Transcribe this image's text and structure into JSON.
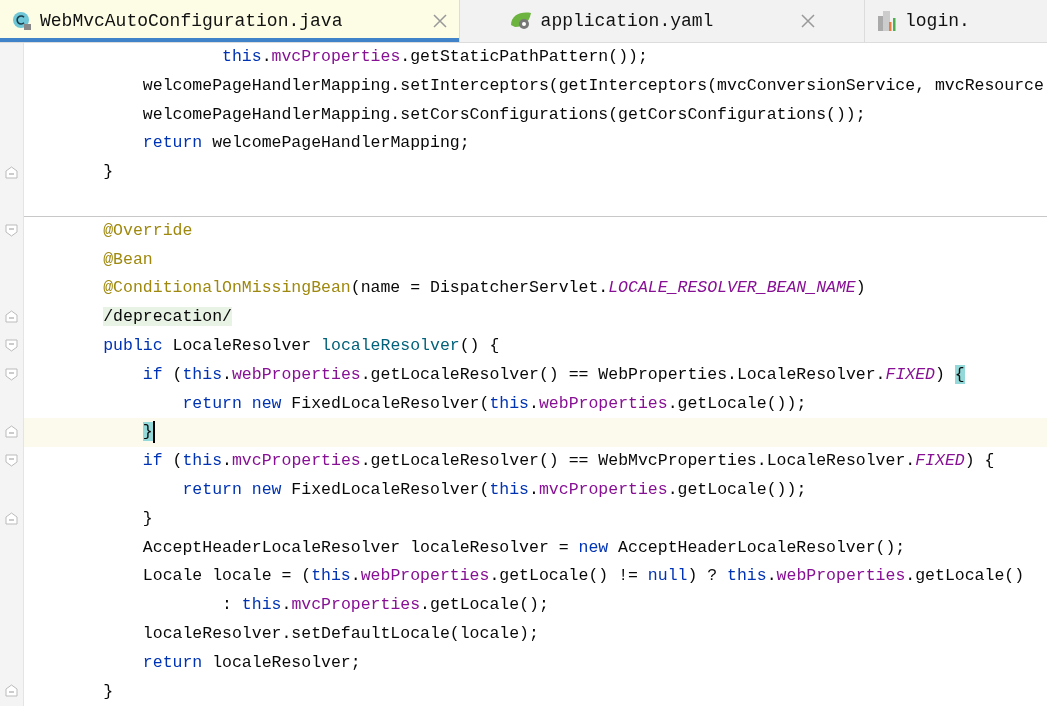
{
  "tabs": [
    {
      "label": "WebMvcAutoConfiguration.java",
      "kind": "java_class",
      "selected": true,
      "closable": true
    },
    {
      "label": "application.yaml",
      "kind": "spring",
      "selected": false,
      "closable": true
    },
    {
      "label": "login.",
      "kind": "html",
      "selected": false,
      "closable": false
    }
  ],
  "lines": [
    {
      "tokens": [
        {
          "kind": "keyword",
          "text": "                    this"
        },
        {
          "kind": "plain",
          "text": "."
        },
        {
          "kind": "field",
          "text": "mvcProperties"
        },
        {
          "kind": "plain",
          "text": ".getStaticPathPattern());"
        }
      ]
    },
    {
      "tokens": [
        {
          "kind": "plain",
          "text": "            welcomePageHandlerMapping.setInterceptors(getInterceptors(mvcConversionService, mvcResource"
        }
      ]
    },
    {
      "tokens": [
        {
          "kind": "plain",
          "text": "            welcomePageHandlerMapping.setCorsConfigurations(getCorsConfigurations());"
        }
      ]
    },
    {
      "tokens": [
        {
          "kind": "keyword",
          "text": "            return"
        },
        {
          "kind": "plain",
          "text": " welcomePageHandlerMapping;"
        }
      ]
    },
    {
      "fold": {
        "kind": "end"
      },
      "tokens": [
        {
          "kind": "plain",
          "text": "        }"
        }
      ]
    },
    {
      "fold": {
        "kind": "start"
      },
      "separator_above": true,
      "tokens": [
        {
          "kind": "annotation",
          "text": "        @Override"
        }
      ]
    },
    {
      "tokens": [
        {
          "kind": "annotation",
          "text": "        @Bean"
        }
      ]
    },
    {
      "tokens": [
        {
          "kind": "annotation",
          "text": "        @ConditionalOnMissingBean"
        },
        {
          "kind": "plain",
          "text": "(name = DispatcherServlet."
        },
        {
          "kind": "constant",
          "text": "LOCALE_RESOLVER_BEAN_NAME"
        },
        {
          "kind": "plain",
          "text": ")"
        }
      ]
    },
    {
      "fold": {
        "kind": "end"
      },
      "tokens": [
        {
          "kind": "folded",
          "text": "        /deprecation/"
        }
      ]
    },
    {
      "fold": {
        "kind": "start"
      },
      "tokens": [
        {
          "kind": "keyword",
          "text": "        public"
        },
        {
          "kind": "plain",
          "text": " LocaleResolver "
        },
        {
          "kind": "method",
          "text": "localeResolver"
        },
        {
          "kind": "plain",
          "text": "() {"
        }
      ]
    },
    {
      "fold": {
        "kind": "start"
      },
      "tokens": [
        {
          "kind": "keyword",
          "text": "            if"
        },
        {
          "kind": "plain",
          "text": " ("
        },
        {
          "kind": "keyword",
          "text": "this"
        },
        {
          "kind": "plain",
          "text": "."
        },
        {
          "kind": "field",
          "text": "webProperties"
        },
        {
          "kind": "plain",
          "text": ".getLocaleResolver() == WebProperties.LocaleResolver."
        },
        {
          "kind": "constant",
          "text": "FIXED"
        },
        {
          "kind": "plain",
          "text": ") "
        },
        {
          "kind": "brace_match",
          "text": "{"
        }
      ]
    },
    {
      "tokens": [
        {
          "kind": "keyword",
          "text": "                return new"
        },
        {
          "kind": "plain",
          "text": " FixedLocaleResolver("
        },
        {
          "kind": "keyword",
          "text": "this"
        },
        {
          "kind": "plain",
          "text": "."
        },
        {
          "kind": "field",
          "text": "webProperties"
        },
        {
          "kind": "plain",
          "text": ".getLocale());"
        }
      ]
    },
    {
      "fold": {
        "kind": "end"
      },
      "current": true,
      "tokens": [
        {
          "kind": "brace_match",
          "text": "            }"
        }
      ]
    },
    {
      "fold": {
        "kind": "start"
      },
      "tokens": [
        {
          "kind": "keyword",
          "text": "            if"
        },
        {
          "kind": "plain",
          "text": " ("
        },
        {
          "kind": "keyword",
          "text": "this"
        },
        {
          "kind": "plain",
          "text": "."
        },
        {
          "kind": "field",
          "text": "mvcProperties"
        },
        {
          "kind": "plain",
          "text": ".getLocaleResolver() == WebMvcProperties.LocaleResolver."
        },
        {
          "kind": "constant",
          "text": "FIXED"
        },
        {
          "kind": "plain",
          "text": ") {"
        }
      ]
    },
    {
      "tokens": [
        {
          "kind": "keyword",
          "text": "                return new"
        },
        {
          "kind": "plain",
          "text": " FixedLocaleResolver("
        },
        {
          "kind": "keyword",
          "text": "this"
        },
        {
          "kind": "plain",
          "text": "."
        },
        {
          "kind": "field",
          "text": "mvcProperties"
        },
        {
          "kind": "plain",
          "text": ".getLocale());"
        }
      ]
    },
    {
      "fold": {
        "kind": "end"
      },
      "tokens": [
        {
          "kind": "plain",
          "text": "            }"
        }
      ]
    },
    {
      "tokens": [
        {
          "kind": "plain",
          "text": "            AcceptHeaderLocaleResolver localeResolver = "
        },
        {
          "kind": "keyword",
          "text": "new"
        },
        {
          "kind": "plain",
          "text": " AcceptHeaderLocaleResolver();"
        }
      ]
    },
    {
      "tokens": [
        {
          "kind": "plain",
          "text": "            Locale locale = ("
        },
        {
          "kind": "keyword",
          "text": "this"
        },
        {
          "kind": "plain",
          "text": "."
        },
        {
          "kind": "field",
          "text": "webProperties"
        },
        {
          "kind": "plain",
          "text": ".getLocale() != "
        },
        {
          "kind": "keyword",
          "text": "null"
        },
        {
          "kind": "plain",
          "text": ") ? "
        },
        {
          "kind": "keyword",
          "text": "this"
        },
        {
          "kind": "plain",
          "text": "."
        },
        {
          "kind": "field",
          "text": "webProperties"
        },
        {
          "kind": "plain",
          "text": ".getLocale()"
        }
      ]
    },
    {
      "tokens": [
        {
          "kind": "plain",
          "text": "                    : "
        },
        {
          "kind": "keyword",
          "text": "this"
        },
        {
          "kind": "plain",
          "text": "."
        },
        {
          "kind": "field",
          "text": "mvcProperties"
        },
        {
          "kind": "plain",
          "text": ".getLocale();"
        }
      ]
    },
    {
      "tokens": [
        {
          "kind": "plain",
          "text": "            localeResolver.setDefaultLocale(locale);"
        }
      ]
    },
    {
      "tokens": [
        {
          "kind": "keyword",
          "text": "            return"
        },
        {
          "kind": "plain",
          "text": " localeResolver;"
        }
      ]
    },
    {
      "fold": {
        "kind": "end"
      },
      "tokens": [
        {
          "kind": "plain",
          "text": "        }"
        }
      ]
    }
  ]
}
